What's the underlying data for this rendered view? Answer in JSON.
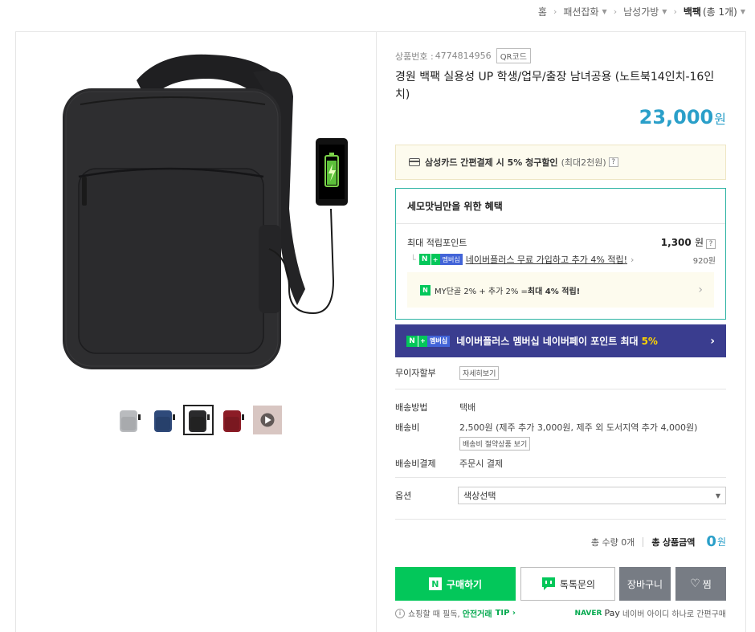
{
  "breadcrumb": {
    "home": "홈",
    "cat1": "패션잡화",
    "cat2": "남성가방",
    "current": "백팩",
    "current_count": "(총 1개)"
  },
  "product": {
    "number_label": "상품번호 :",
    "number": "4774814956",
    "qr_label": "QR코드",
    "title": "경원 백팩 실용성 UP 학생/업무/출장 남녀공용 (노트북14인치-16인치)",
    "price": "23,000",
    "price_unit": "원"
  },
  "thumbnails": [
    {
      "name": "thumb-gray",
      "color": "#b9bbbe"
    },
    {
      "name": "thumb-navy",
      "color": "#2f4a7a"
    },
    {
      "name": "thumb-black",
      "color": "#2a2a2c"
    },
    {
      "name": "thumb-red",
      "color": "#8c1c26"
    },
    {
      "name": "thumb-video",
      "color": "#d8c6c2"
    }
  ],
  "card_discount": {
    "text_bold": "삼성카드 간편결제 시 5% 청구할인",
    "text_sub": "(최대2천원)"
  },
  "benefit": {
    "title": "세모맛님만을 위한 혜택",
    "max_points_label": "최대 적립포인트",
    "max_points": "1,300",
    "points_unit": "원",
    "np_badge_n": "N",
    "np_badge_plus": "+",
    "np_badge_mem": "멤버십",
    "np_link": "네이버플러스 무료 가입하고 추가 4% 적립!",
    "np_amount": "920원",
    "my_n": "N",
    "my_text": "MY단골 2% + 추가 2% = ",
    "my_bold": "최대 4% 적립!"
  },
  "np_banner": {
    "text": "네이버플러스 멤버십 네이버페이 포인트 최대",
    "pct": "5%"
  },
  "installment": {
    "label": "무이자할부",
    "btn": "자세히보기"
  },
  "shipping": {
    "method_label": "배송방법",
    "method": "택배",
    "fee_label": "배송비",
    "fee": "2,500원 (제주 추가 3,000원, 제주 외 도서지역 추가 4,000원)",
    "fee_btn": "배송비 절약상품 보기",
    "pay_label": "배송비결제",
    "pay": "주문시 결제"
  },
  "option": {
    "label": "옵션",
    "placeholder": "색상선택"
  },
  "total": {
    "qty_label": "총 수량",
    "qty": "0개",
    "amount_label_pre": "총",
    "amount_label": "상품금액",
    "amount": "0",
    "unit": "원"
  },
  "buttons": {
    "buy": "구매하기",
    "buy_n": "N",
    "talk": "톡톡문의",
    "cart": "장바구니",
    "zzim": "찜"
  },
  "footer": {
    "notice_pre": "쇼핑할 때 필독,",
    "notice_safe": "안전거래",
    "notice_tip": "TIP ›",
    "naver": "NAVER",
    "pay": "Pay",
    "pay_desc": "네이버 아이디 하나로 간편구매"
  },
  "colors": {
    "accent_blue": "#2a9fc9",
    "naver_green": "#03c75a",
    "banner_navy": "#3a3d8f",
    "benefit_border": "#2fb4a4"
  }
}
